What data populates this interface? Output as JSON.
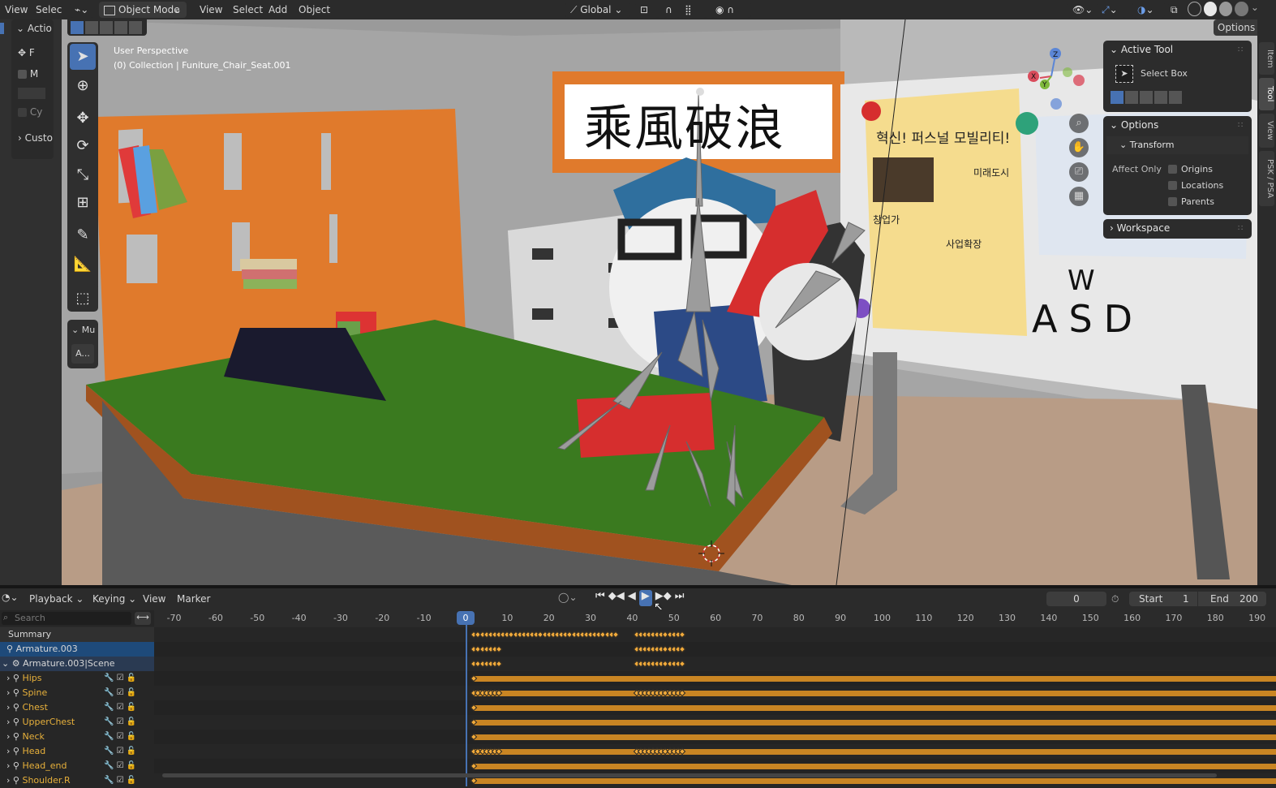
{
  "top_menu": {
    "view": "View",
    "select": "Selec",
    "object_mode": "Object Mode",
    "view2": "View",
    "select2": "Select",
    "add": "Add",
    "object": "Object",
    "transform_orientation": "Global",
    "options": "Options"
  },
  "left_panel": {
    "action_label": "Actio",
    "f_label": "F",
    "m_label": "M",
    "cy_label": "Cy",
    "custom_label": "Custo"
  },
  "viewport": {
    "perspective": "User Perspective",
    "collection": "(0) Collection | Funiture_Chair_Seat.001"
  },
  "toolbar_extra": {
    "mu_label": "Mu",
    "a_label": "A..."
  },
  "npanel": {
    "active_tool_title": "Active Tool",
    "select_box": "Select Box",
    "options_title": "Options",
    "transform_title": "Transform",
    "affect_only": "Affect Only",
    "origins": "Origins",
    "locations": "Locations",
    "parents": "Parents",
    "workspace_title": "Workspace"
  },
  "side_tabs": [
    "Item",
    "Tool",
    "View",
    "PSK / PSA"
  ],
  "scene_text": {
    "sign": "乘風破浪",
    "poster_title": "혁신! 퍼스널 모빌리티!",
    "poster_l1": "미래도시",
    "poster_l2": "창업가",
    "poster_l3": "사업확장",
    "board_w": "W",
    "board_asd": "ASD"
  },
  "timeline": {
    "playback": "Playback",
    "keying": "Keying",
    "view": "View",
    "marker": "Marker",
    "current_frame": "0",
    "start_label": "Start",
    "start_value": "1",
    "end_label": "End",
    "end_value": "200",
    "search_placeholder": "Search"
  },
  "ruler_ticks": [
    "-70",
    "-60",
    "-50",
    "-40",
    "-30",
    "-20",
    "-10",
    "0",
    "10",
    "20",
    "30",
    "40",
    "50",
    "60",
    "70",
    "80",
    "90",
    "100",
    "110",
    "120",
    "130",
    "140",
    "150",
    "160",
    "170",
    "180",
    "190"
  ],
  "channels": [
    {
      "name": "Summary",
      "kind": "summary"
    },
    {
      "name": "Armature.003",
      "kind": "object"
    },
    {
      "name": "Armature.003|Scene",
      "kind": "action"
    },
    {
      "name": "Hips",
      "kind": "bone"
    },
    {
      "name": "Spine",
      "kind": "bone"
    },
    {
      "name": "Chest",
      "kind": "bone"
    },
    {
      "name": "UpperChest",
      "kind": "bone"
    },
    {
      "name": "Neck",
      "kind": "bone"
    },
    {
      "name": "Head",
      "kind": "bone"
    },
    {
      "name": "Head_end",
      "kind": "bone"
    },
    {
      "name": "Shoulder.R",
      "kind": "bone"
    }
  ],
  "colors": {
    "accent": "#4772b3",
    "keyframe": "#e8a033",
    "bone_text": "#e7b03b",
    "hold_bar": "#c98523"
  }
}
